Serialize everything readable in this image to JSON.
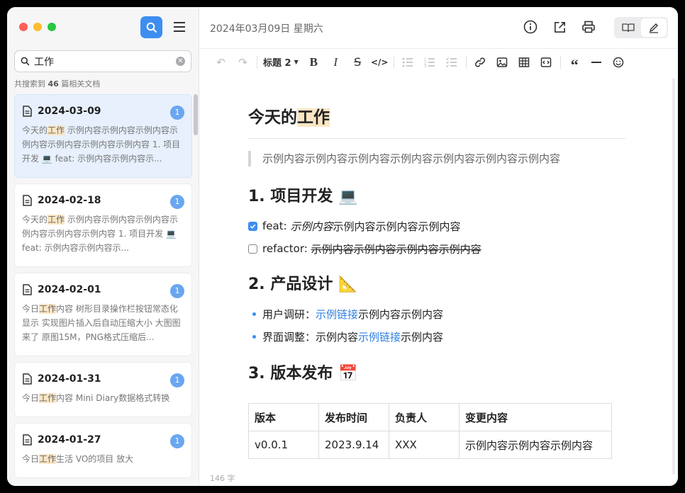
{
  "sidebar": {
    "search_value": "工作",
    "result_prefix": "共搜索到",
    "result_count": "46",
    "result_suffix": "篇相关文档",
    "docs": [
      {
        "date": "2024-03-09",
        "badge": "1",
        "pre": "今天的",
        "hl": "工作",
        "post": " 示例内容示例内容示例内容示例内容示例内容示例内容示例内容 1. 项目开发 💻 feat: 示例内容示例内容示..."
      },
      {
        "date": "2024-02-18",
        "badge": "1",
        "pre": "今天的",
        "hl": "工作",
        "post": " 示例内容示例内容示例内容示例内容示例内容示例内容 1. 项目开发 💻 feat: 示例内容示例内容示..."
      },
      {
        "date": "2024-02-01",
        "badge": "1",
        "pre": "今日",
        "hl": "工作",
        "post": "内容 树形目录操作栏按钮常态化显示 实现图片插入后自动压缩大小 大图图来了 原图15M，PNG格式压缩后..."
      },
      {
        "date": "2024-01-31",
        "badge": "1",
        "pre": "今日",
        "hl": "工作",
        "post": "内容 Mini Diary数据格式转换"
      },
      {
        "date": "2024-01-27",
        "badge": "1",
        "pre": "今日",
        "hl": "工作",
        "post": "生活 VO的项目 放大"
      }
    ]
  },
  "header": {
    "date_title": "2024年03月09日 星期六"
  },
  "toolbar": {
    "heading_label": "标题 2"
  },
  "editor": {
    "title_pre": "今天的",
    "title_hl": "工作",
    "quote": "示例内容示例内容示例内容示例内容示例内容示例内容示例内容",
    "h1": "1. 项目开发 💻",
    "task1_label": "feat: ",
    "task1_italic": "示例内容",
    "task1_rest": "示例内容示例内容示例内容",
    "task2_label": "refactor: ",
    "task2_strike": "示例内容示例内容示例内容示例内容",
    "h2": "2. 产品设计 📐",
    "b1_label": "用户调研：",
    "b1_link": "示例链接",
    "b1_rest": "示例内容示例内容",
    "b2_label": "界面调整：示例内容",
    "b2_link": "示例链接",
    "b2_rest": "示例内容",
    "h3": "3. 版本发布 📅",
    "table_headers": [
      "版本",
      "发布时间",
      "负责人",
      "变更内容"
    ],
    "table_row": [
      "v0.0.1",
      "2023.9.14",
      "XXX",
      "示例内容示例内容示例内容"
    ]
  },
  "footer": {
    "word_count": "146 字"
  },
  "colors": {
    "accent": "#3d8ef0",
    "highlight": "#fbe6c4",
    "link": "#2f7fe0"
  }
}
